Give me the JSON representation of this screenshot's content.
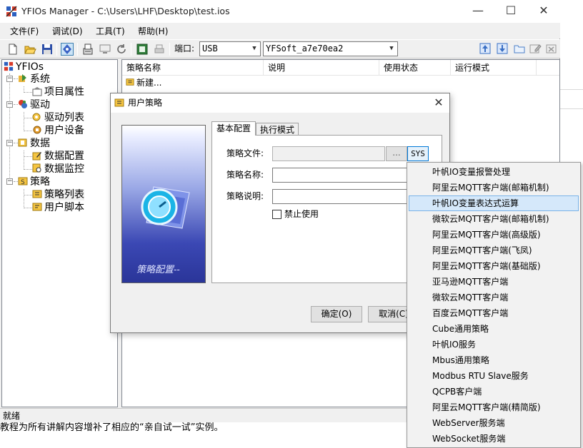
{
  "window": {
    "title": "YFIOs Manager - C:\\Users\\LHF\\Desktop\\test.ios",
    "minimize": "—",
    "maximize": "☐",
    "close": "✕"
  },
  "menu": [
    "文件(F)",
    "调试(D)",
    "工具(T)",
    "帮助(H)"
  ],
  "toolbar": {
    "port_label": "端口:",
    "port_value": "USB",
    "device_value": "YFSoft_a7e70ea2",
    "dropdown_arrow": "▼"
  },
  "tree": {
    "root": "YFIOs",
    "groups": [
      {
        "label": "系统",
        "children": [
          "项目属性"
        ]
      },
      {
        "label": "驱动",
        "children": [
          "驱动列表",
          "用户设备"
        ]
      },
      {
        "label": "数据",
        "children": [
          "数据配置",
          "数据监控"
        ]
      },
      {
        "label": "策略",
        "children": [
          "策略列表",
          "用户脚本"
        ]
      }
    ],
    "toggle": "−"
  },
  "list": {
    "columns": [
      "策略名称",
      "说明",
      "使用状态",
      "运行模式"
    ],
    "rows": [
      "新建..."
    ]
  },
  "status": "就绪",
  "background_text": "教程为所有讲解内容增补了相应的“亲自试一试”实例。",
  "dialog": {
    "title": "用户策略",
    "close": "✕",
    "image_caption": "策略配置--",
    "tabs": [
      "基本配置",
      "执行模式"
    ],
    "labels": {
      "file": "策略文件:",
      "name": "策略名称:",
      "desc": "策略说明:"
    },
    "browse": "...",
    "sys": "SYS",
    "disable": "禁止使用",
    "ok": "确定(O)",
    "cancel": "取消(C)"
  },
  "popup": {
    "selected_index": 2,
    "items": [
      "叶帆IO变量报警处理",
      "阿里云MQTT客户端(邮箱机制)",
      "叶帆IO变量表达式运算",
      "微软云MQTT客户端(邮箱机制)",
      "阿里云MQTT客户端(高级版)",
      "阿里云MQTT客户端(飞凤)",
      "阿里云MQTT客户端(基础版)",
      "亚马逊MQTT客户端",
      "微软云MQTT客户端",
      "百度云MQTT客户端",
      "Cube通用策略",
      "叶帆IO服务",
      "Mbus通用策略",
      "Modbus RTU Slave服务",
      "QCPB客户端",
      "阿里云MQTT客户端(精简版)",
      "WebServer服务端",
      "WebSocket服务端"
    ]
  }
}
